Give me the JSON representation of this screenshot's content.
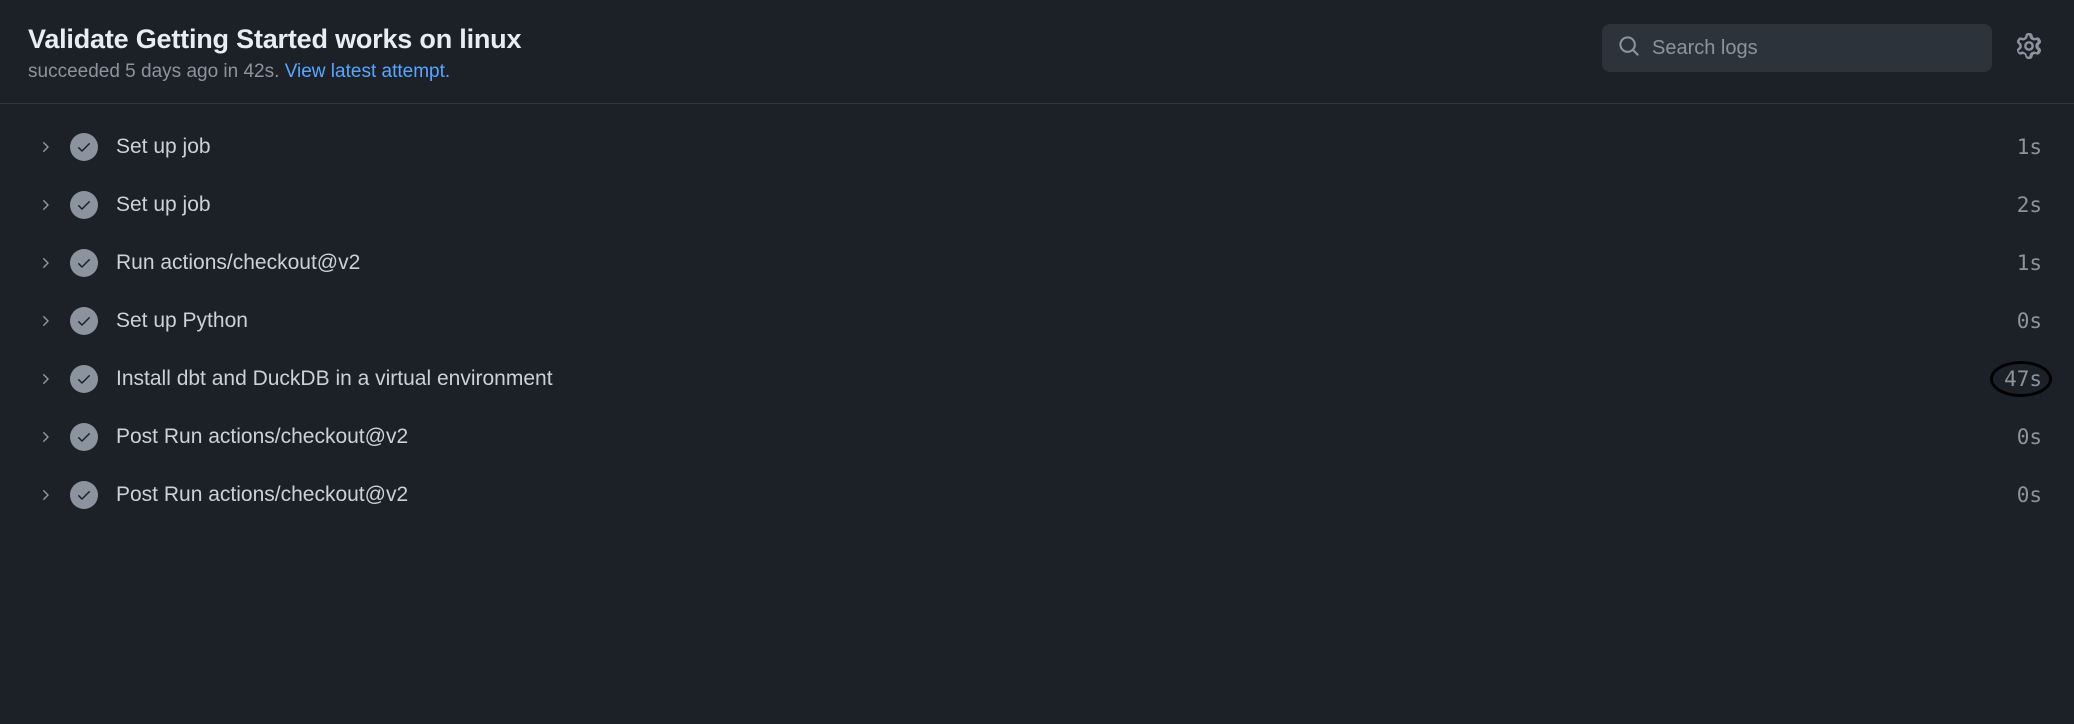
{
  "header": {
    "title": "Validate Getting Started works on linux",
    "status_text": "succeeded 5 days ago in 42s. ",
    "link_text": "View latest attempt."
  },
  "search": {
    "placeholder": "Search logs"
  },
  "steps": [
    {
      "name": "Set up job",
      "duration": "1s",
      "highlighted": false
    },
    {
      "name": "Set up job",
      "duration": "2s",
      "highlighted": false
    },
    {
      "name": "Run actions/checkout@v2",
      "duration": "1s",
      "highlighted": false
    },
    {
      "name": "Set up Python",
      "duration": "0s",
      "highlighted": false
    },
    {
      "name": "Install dbt and DuckDB in a virtual environment",
      "duration": "47s",
      "highlighted": true
    },
    {
      "name": "Post Run actions/checkout@v2",
      "duration": "0s",
      "highlighted": false
    },
    {
      "name": "Post Run actions/checkout@v2",
      "duration": "0s",
      "highlighted": false
    }
  ]
}
